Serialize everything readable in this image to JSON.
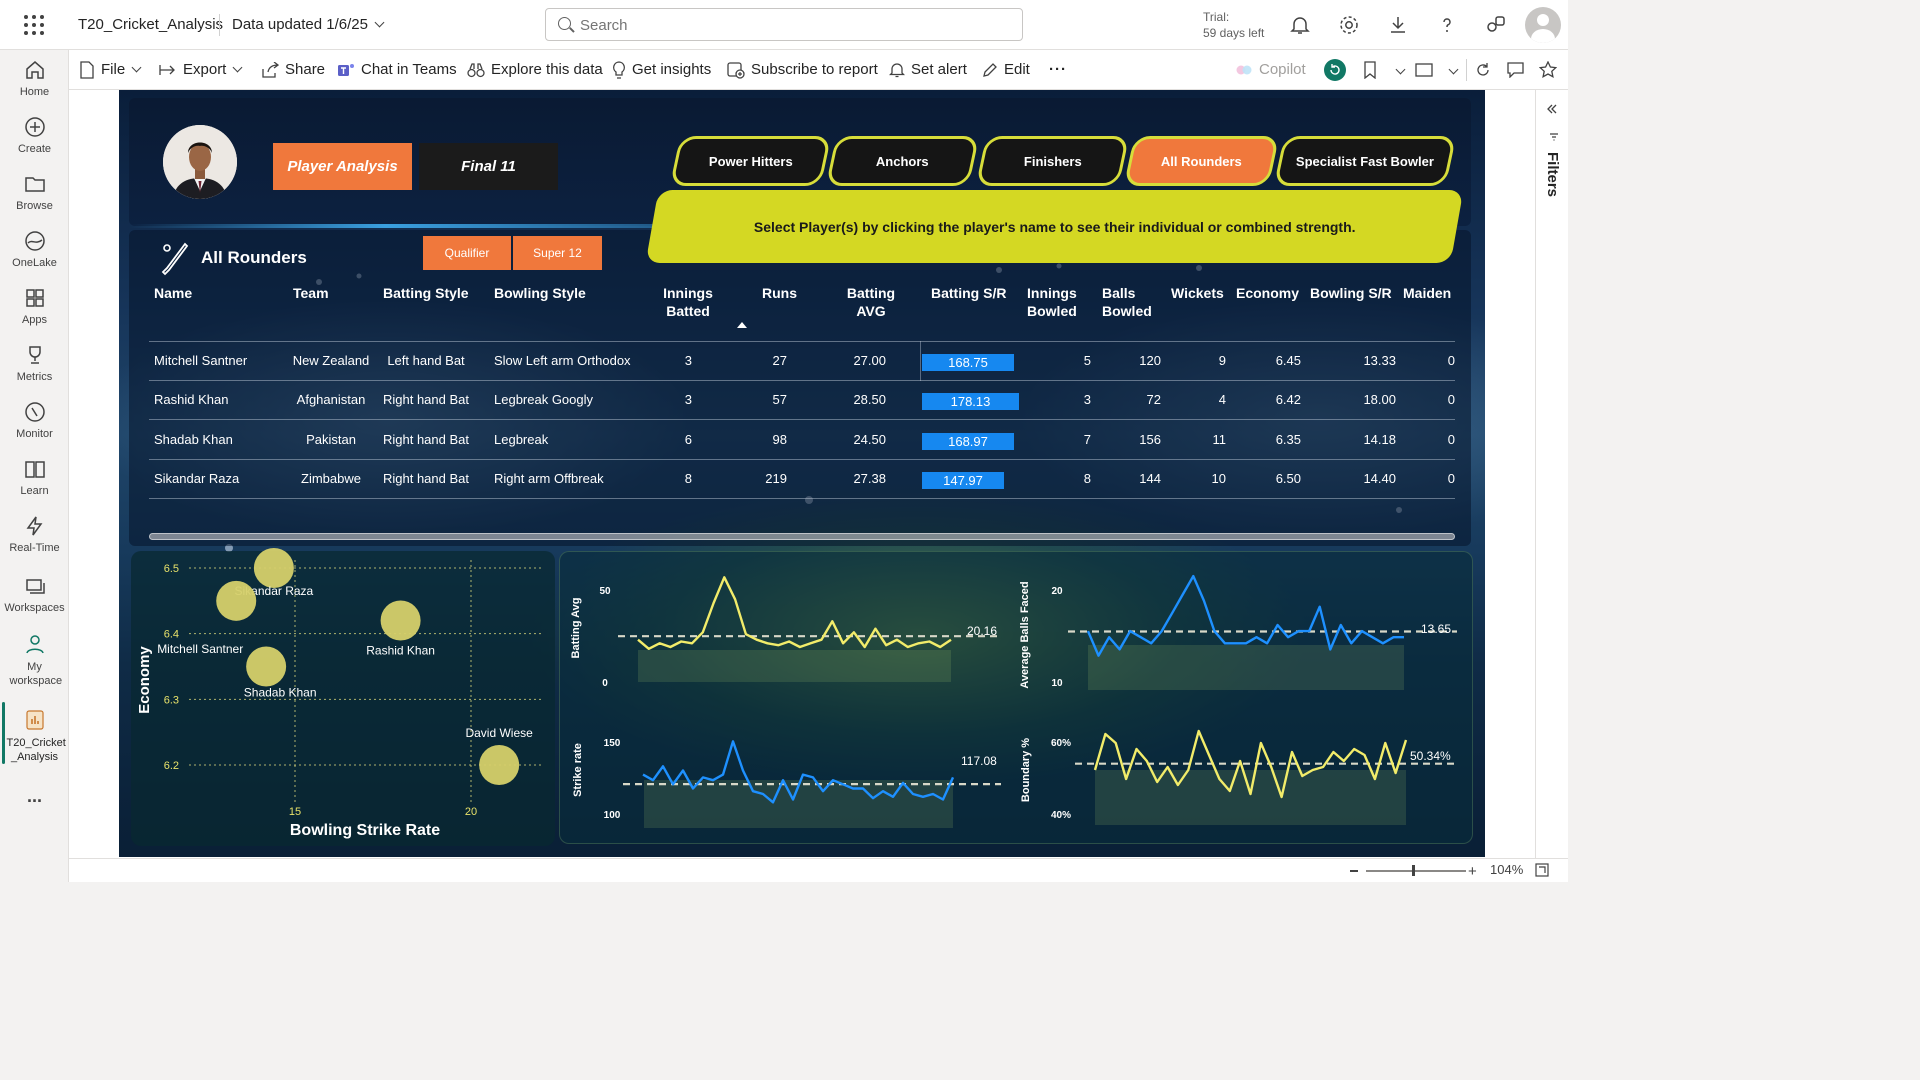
{
  "app": {
    "title": "T20_Cricket_Analysis",
    "data_updated": "Data updated 1/6/25",
    "search_placeholder": "Search",
    "trial_line1": "Trial:",
    "trial_line2": "59 days left"
  },
  "nav": [
    {
      "label": "Home",
      "icon": "home-icon"
    },
    {
      "label": "Create",
      "icon": "plus-circle-icon"
    },
    {
      "label": "Browse",
      "icon": "folder-icon"
    },
    {
      "label": "OneLake",
      "icon": "onelake-icon"
    },
    {
      "label": "Apps",
      "icon": "apps-icon"
    },
    {
      "label": "Metrics",
      "icon": "trophy-icon"
    },
    {
      "label": "Monitor",
      "icon": "monitor-icon"
    },
    {
      "label": "Learn",
      "icon": "book-icon"
    },
    {
      "label": "Real-Time",
      "icon": "lightning-icon"
    },
    {
      "label": "Workspaces",
      "icon": "workspaces-icon"
    },
    {
      "label": "My workspace",
      "icon": "person-icon"
    },
    {
      "label": "T20_Cricket _Analysis",
      "icon": "report-icon"
    },
    {
      "label": "...",
      "icon": "more-icon"
    }
  ],
  "commands": {
    "file": "File",
    "export": "Export",
    "share": "Share",
    "chat_in_teams": "Chat in Teams",
    "explore": "Explore this data",
    "insights": "Get insights",
    "subscribe": "Subscribe to report",
    "alert": "Set alert",
    "edit": "Edit",
    "more": "···",
    "copilot": "Copilot"
  },
  "report": {
    "tab_player_analysis": "Player Analysis",
    "tab_final11": "Final 11",
    "categories": [
      "Power Hitters",
      "Anchors",
      "Finishers",
      "All Rounders",
      "Specialist Fast Bowler"
    ],
    "active_category": "All Rounders",
    "instruction": "Select Player(s) by clicking the player's name to see their individual or combined strength.",
    "section_title": "All Rounders",
    "filter_qualifier": "Qualifier",
    "filter_super12": "Super 12",
    "table": {
      "headers": [
        "Name",
        "Team",
        "Batting Style",
        "Bowling Style",
        "Innings Batted",
        "Runs",
        "Batting AVG",
        "Batting S/R",
        "Innings Bowled",
        "Balls Bowled",
        "Wickets",
        "Economy",
        "Bowling S/R",
        "Maiden"
      ],
      "rows": [
        {
          "name": "Mitchell Santner",
          "team": "New Zealand",
          "bat": "Left hand Bat",
          "bowl": "Slow Left arm Orthodox",
          "inn": "3",
          "runs": "27",
          "avg": "27.00",
          "sr": "168.75",
          "inn_b": "5",
          "balls": "120",
          "wkts": "9",
          "econ": "6.45",
          "bsr": "13.33",
          "maiden": "0"
        },
        {
          "name": "Rashid Khan",
          "team": "Afghanistan",
          "bat": "Right hand Bat",
          "bowl": "Legbreak Googly",
          "inn": "3",
          "runs": "57",
          "avg": "28.50",
          "sr": "178.13",
          "inn_b": "3",
          "balls": "72",
          "wkts": "4",
          "econ": "6.42",
          "bsr": "18.00",
          "maiden": "0"
        },
        {
          "name": "Shadab Khan",
          "team": "Pakistan",
          "bat": "Right hand Bat",
          "bowl": "Legbreak",
          "inn": "6",
          "runs": "98",
          "avg": "24.50",
          "sr": "168.97",
          "inn_b": "7",
          "balls": "156",
          "wkts": "11",
          "econ": "6.35",
          "bsr": "14.18",
          "maiden": "0"
        },
        {
          "name": "Sikandar Raza",
          "team": "Zimbabwe",
          "bat": "Right hand Bat",
          "bowl": "Right arm Offbreak",
          "inn": "8",
          "runs": "219",
          "avg": "27.38",
          "sr": "147.97",
          "inn_b": "8",
          "balls": "144",
          "wkts": "10",
          "econ": "6.50",
          "bsr": "14.40",
          "maiden": "0"
        }
      ]
    }
  },
  "colors": {
    "orange": "#f0783c",
    "yellow": "#d4d823",
    "bar_blue": "#1688f0",
    "line_yellow": "#f2ec6a",
    "line_blue": "#1e90ff"
  },
  "chart_data": [
    {
      "type": "scatter",
      "xlabel": "Bowling Strike Rate",
      "ylabel": "Economy",
      "x_ticks": [
        "15",
        "20"
      ],
      "y_ticks": [
        "6.5",
        "6.4",
        "6.3",
        "6.2"
      ],
      "points": [
        {
          "label": "Sikandar Raza",
          "x": 14.4,
          "y": 6.5
        },
        {
          "label": "Mitchell Santner",
          "x": 13.33,
          "y": 6.45
        },
        {
          "label": "Rashid Khan",
          "x": 18.0,
          "y": 6.42
        },
        {
          "label": "Shadab Khan",
          "x": 14.18,
          "y": 6.35
        },
        {
          "label": "David Wiese",
          "x": 20.8,
          "y": 6.2
        }
      ]
    },
    {
      "type": "line",
      "ylabel": "Batting Avg",
      "y_ticks": [
        "50",
        "0"
      ],
      "ylim": [
        0,
        60
      ],
      "avg_label": "20.16",
      "values": [
        22,
        17,
        20,
        18,
        21,
        20,
        26,
        42,
        56,
        44,
        25,
        22,
        20,
        19,
        21,
        18,
        20,
        22,
        32,
        20,
        26,
        18,
        28,
        19,
        22,
        18,
        20,
        21,
        18,
        22
      ]
    },
    {
      "type": "line",
      "ylabel": "Average Balls Faced",
      "y_ticks": [
        "20",
        "10"
      ],
      "ylim": [
        6,
        24
      ],
      "avg_label": "13.65",
      "values": [
        14,
        10,
        13,
        11,
        14,
        13,
        12,
        14,
        17,
        20,
        23,
        19,
        14,
        12,
        12,
        12,
        13,
        12,
        15,
        13,
        14,
        14,
        18,
        11,
        15,
        12,
        14,
        13,
        12,
        13,
        13
      ]
    },
    {
      "type": "line",
      "ylabel": "Strike rate",
      "y_ticks": [
        "150",
        "100"
      ],
      "ylim": [
        95,
        160
      ],
      "avg_label": "117.08",
      "values": [
        122,
        118,
        128,
        115,
        125,
        112,
        120,
        118,
        122,
        146,
        125,
        110,
        108,
        102,
        118,
        104,
        122,
        120,
        110,
        118,
        115,
        112,
        112,
        105,
        110,
        106,
        116,
        108,
        106,
        108,
        104,
        120
      ]
    },
    {
      "type": "line",
      "ylabel": "Boundary %",
      "y_ticks": [
        "60%",
        "40%"
      ],
      "ylim": [
        35,
        65
      ],
      "avg_label": "50.34%",
      "values": [
        49,
        61,
        58,
        46,
        56,
        52,
        45,
        50,
        44,
        49,
        62,
        54,
        46,
        42,
        52,
        41,
        58,
        50,
        40,
        55,
        47,
        49,
        50,
        55,
        52,
        56,
        54,
        46,
        58,
        48,
        59
      ]
    }
  ]
}
